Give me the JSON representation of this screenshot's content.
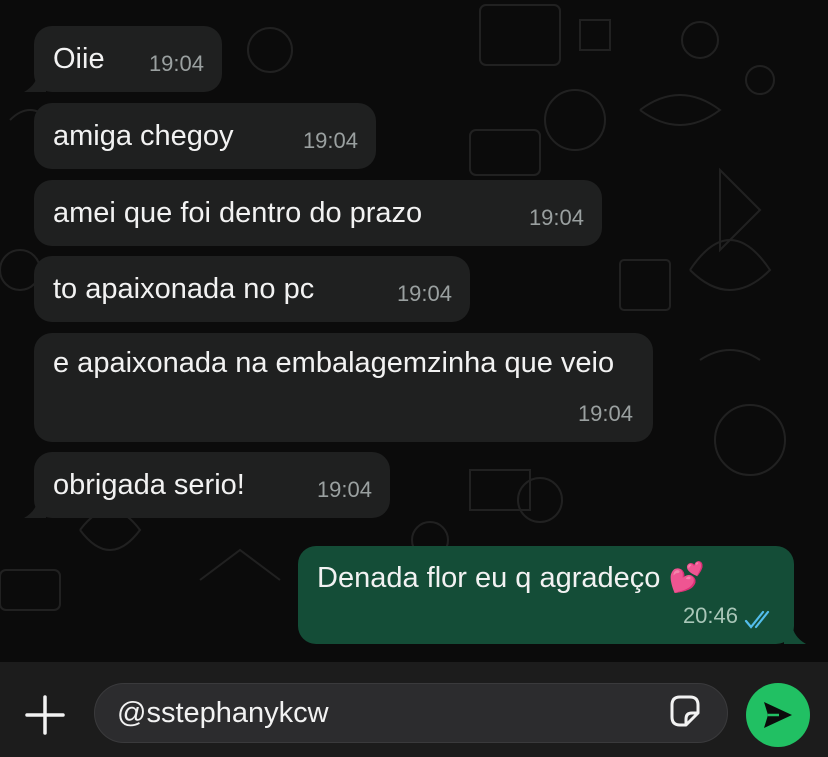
{
  "colors": {
    "chat_background": "#0b0b0b",
    "incoming_bubble": "#1f2020",
    "outgoing_bubble": "#144d37",
    "read_ticks": "#53bdeb",
    "send_button": "#21c063",
    "input_bar": "#1c1c1c"
  },
  "messages": [
    {
      "text": "Oiie",
      "time": "19:04",
      "direction": "incoming"
    },
    {
      "text": "amiga chegoy",
      "time": "19:04",
      "direction": "incoming"
    },
    {
      "text": "amei que foi dentro do prazo",
      "time": "19:04",
      "direction": "incoming"
    },
    {
      "text": "to apaixonada no pc",
      "time": "19:04",
      "direction": "incoming"
    },
    {
      "text": "e apaixonada na embalagemzinha que veio",
      "time": "19:04",
      "direction": "incoming"
    },
    {
      "text": "obrigada serio!",
      "time": "19:04",
      "direction": "incoming"
    },
    {
      "text": "Denada flor eu q agradeço 💕",
      "time": "20:46",
      "direction": "outgoing",
      "status": "read"
    }
  ],
  "composer": {
    "value": "@sstephanykcw",
    "attach_icon": "plus-icon",
    "sticker_icon": "sticker-icon",
    "send_icon": "send-icon"
  }
}
